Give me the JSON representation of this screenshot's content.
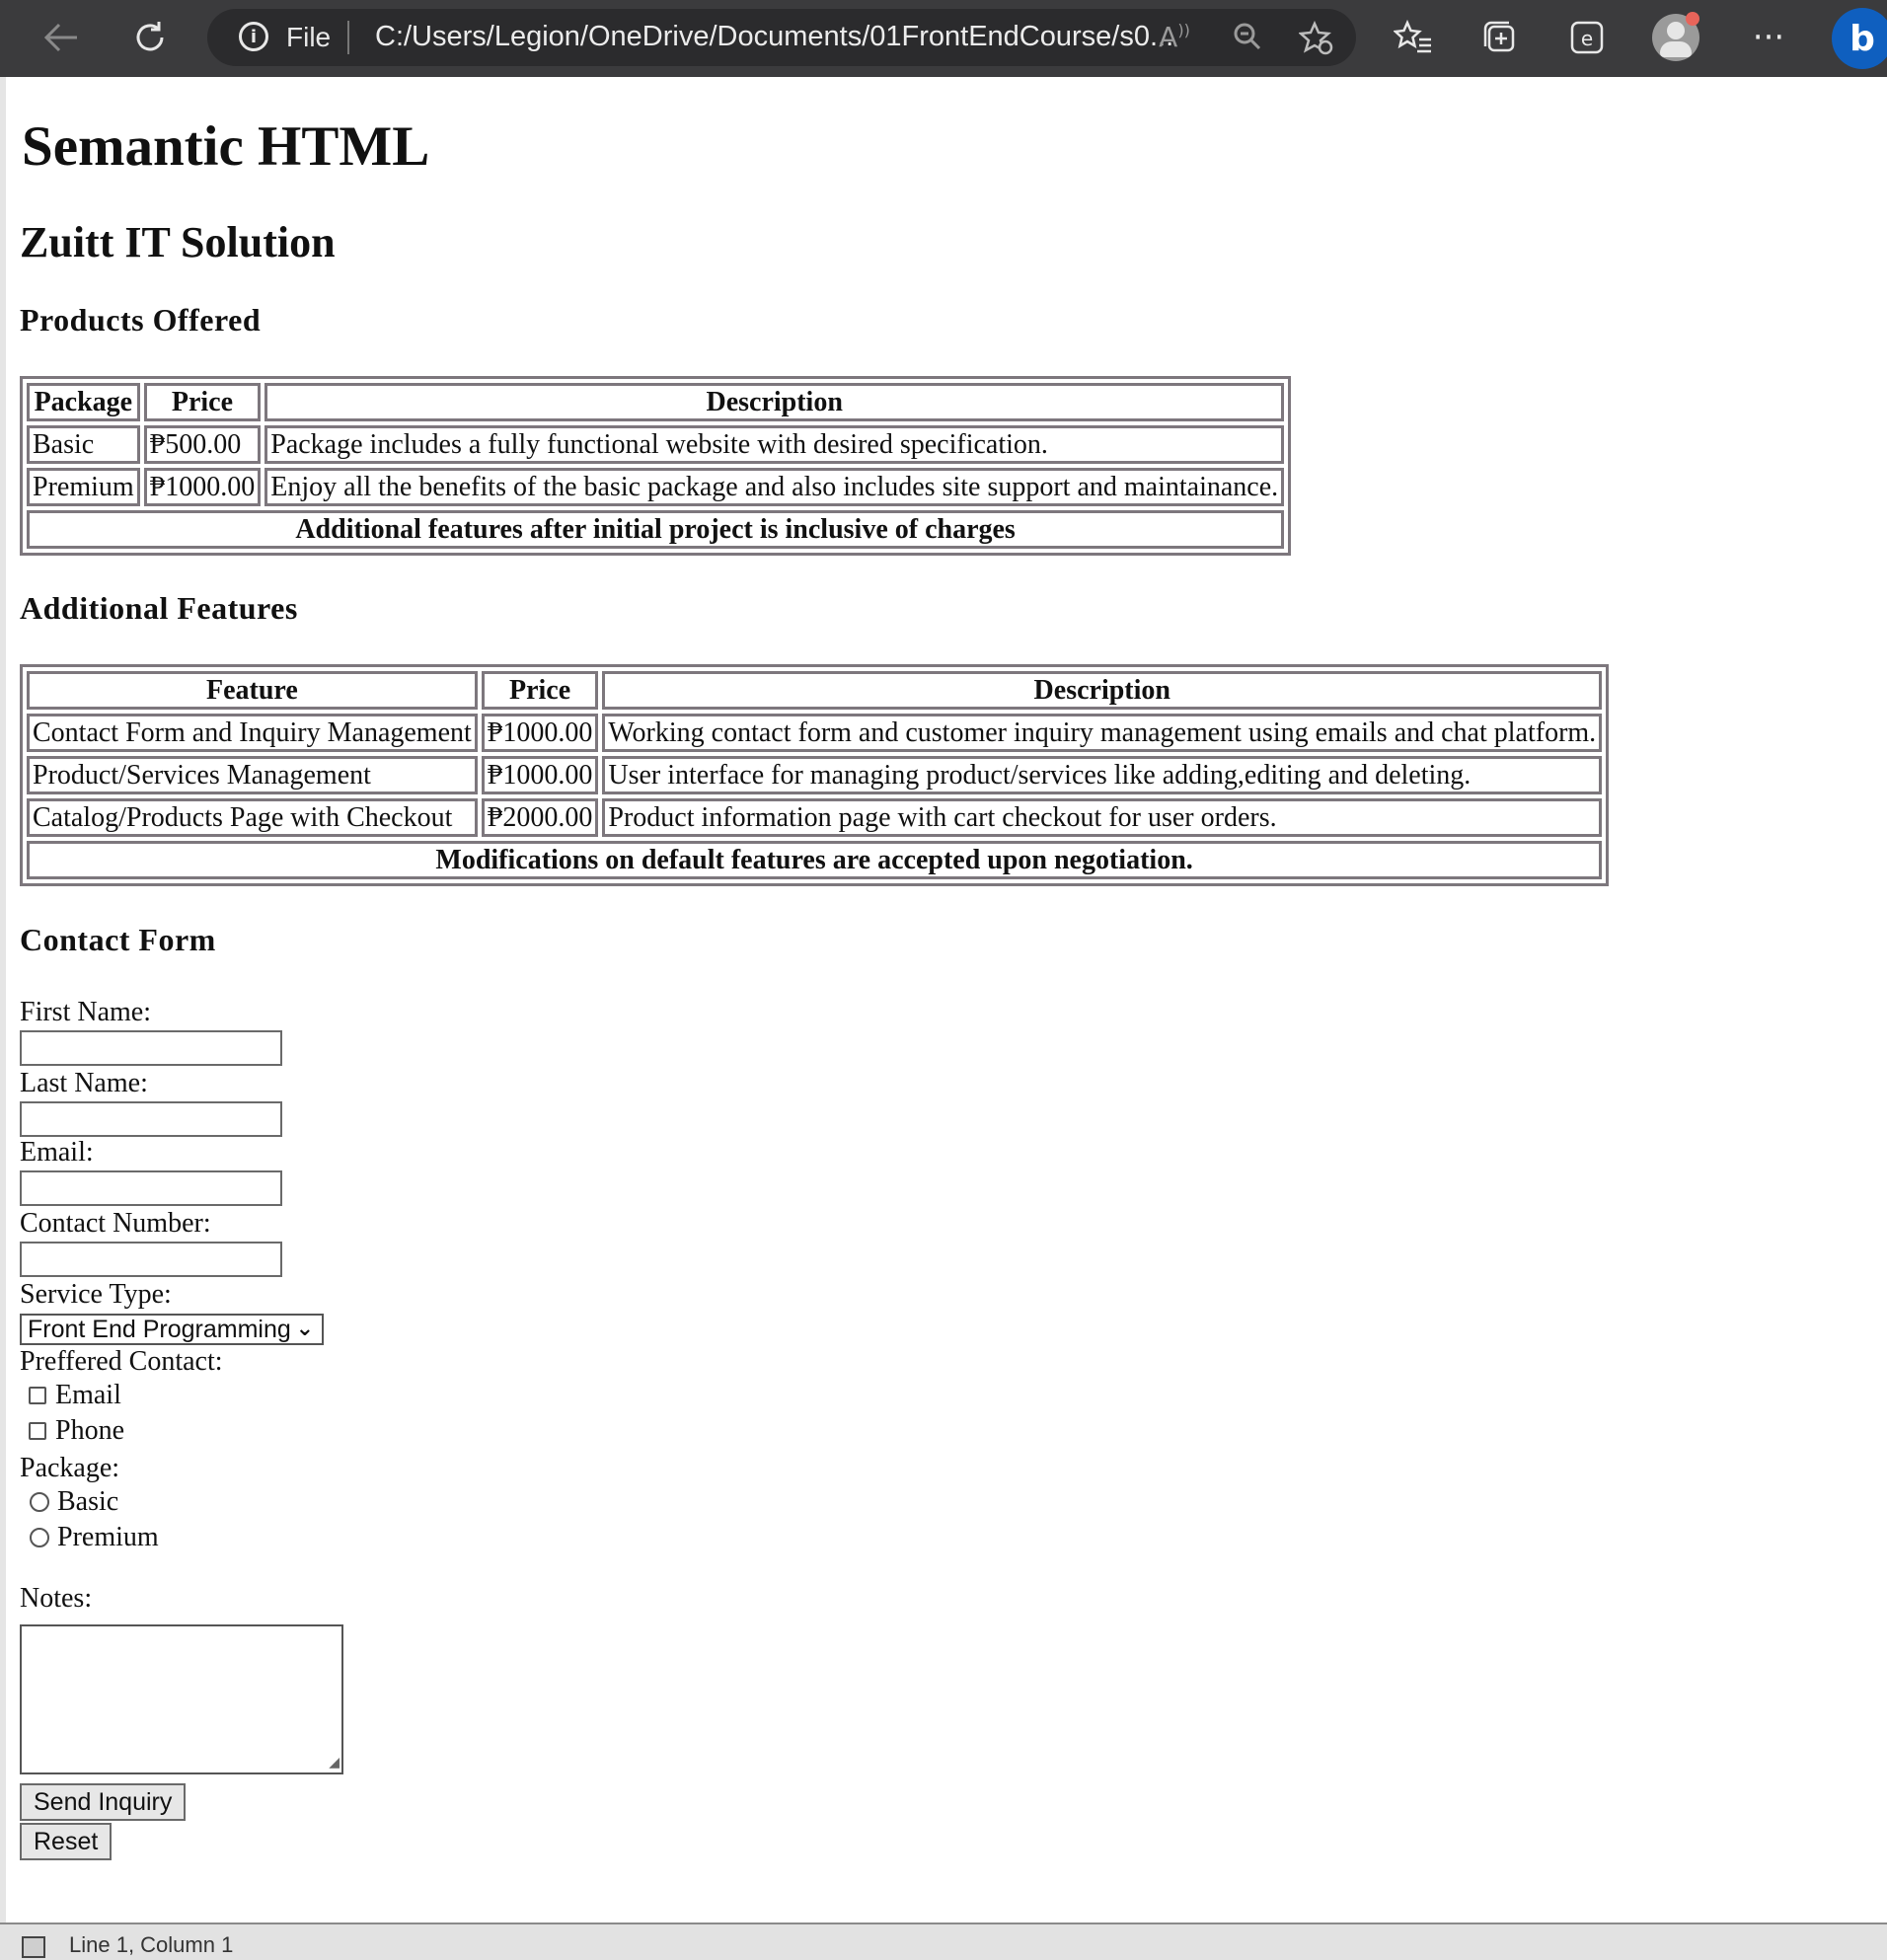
{
  "browser": {
    "file_label": "File",
    "address": "C:/Users/Legion/OneDrive/Documents/01FrontEndCourse/s0...",
    "icons": [
      "back-arrow-icon",
      "refresh-icon",
      "info-icon",
      "read-aloud-icon",
      "zoom-out-icon",
      "favorite-star-icon",
      "favorites-list-icon",
      "collections-icon",
      "browser-essentials-icon",
      "profile-avatar-icon",
      "more-icon",
      "bing-copilot-icon"
    ],
    "colors": {
      "toolbar": "#3b3b3d",
      "address_bar": "#2b2b2d",
      "bing": "#0f5fbf",
      "profile_dot": "#e8645a"
    }
  },
  "page": {
    "title": "Semantic HTML",
    "company": "Zuitt IT Solution",
    "products": {
      "heading": "Products Offered",
      "columns": [
        "Package",
        "Price",
        "Description"
      ],
      "rows": [
        [
          "Basic",
          "₱500.00",
          "Package includes a fully functional website with desired specification."
        ],
        [
          "Premium",
          "₱1000.00",
          "Enjoy all the benefits of the basic package and also includes site support and maintainance."
        ]
      ],
      "footer": "Additional features after initial project is inclusive of charges"
    },
    "features": {
      "heading": "Additional Features",
      "columns": [
        "Feature",
        "Price",
        "Description"
      ],
      "rows": [
        [
          "Contact Form and Inquiry Management",
          "₱1000.00",
          "Working contact form and customer inquiry management using emails and chat platform."
        ],
        [
          "Product/Services Management",
          "₱1000.00",
          "User interface for managing product/services like adding,editing and deleting."
        ],
        [
          "Catalog/Products Page with Checkout",
          "₱2000.00",
          "Product information page with cart checkout for user orders."
        ]
      ],
      "footer": "Modifications on default features are accepted upon negotiation."
    },
    "contact_form": {
      "heading": "Contact Form",
      "first_name_label": "First Name:",
      "first_name_value": "",
      "last_name_label": "Last Name:",
      "last_name_value": "",
      "email_label": "Email:",
      "email_value": "",
      "contact_number_label": "Contact Number:",
      "contact_number_value": "",
      "service_type_label": "Service Type:",
      "service_type_selected": "Front End Programming",
      "preferred_contact_label": "Preffered Contact:",
      "preferred_contact_options": [
        {
          "label": "Email",
          "checked": false
        },
        {
          "label": "Phone",
          "checked": false
        }
      ],
      "package_label": "Package:",
      "package_options": [
        {
          "label": "Basic",
          "selected": false
        },
        {
          "label": "Premium",
          "selected": false
        }
      ],
      "notes_label": "Notes:",
      "notes_value": "",
      "submit_label": "Send Inquiry",
      "reset_label": "Reset"
    }
  },
  "status_bar": {
    "text": "Line 1, Column 1"
  }
}
